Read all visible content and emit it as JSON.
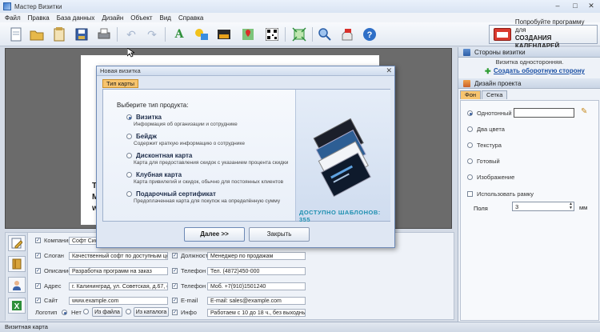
{
  "window": {
    "title": "Мастер Визитки"
  },
  "menu": [
    "Файл",
    "Правка",
    "База данных",
    "Дизайн",
    "Объект",
    "Вид",
    "Справка"
  ],
  "toolbar": {
    "icons": [
      "new-document-icon",
      "open-folder-icon",
      "templates-icon",
      "save-icon",
      "print-icon",
      "undo-icon",
      "redo-icon",
      "text-icon",
      "shape-icon",
      "image-icon",
      "map-icon",
      "qr-code-icon",
      "crop-icon",
      "zoom-icon",
      "web-icon",
      "help-icon"
    ],
    "promo": {
      "line1": "Попробуйте программу для",
      "line2": "СОЗДАНИЯ КАЛЕНДАРЕЙ"
    }
  },
  "canvas": {
    "frag1": "T",
    "frag2": "M",
    "frag3": "w"
  },
  "right_panel": {
    "sides_header": "Стороны визитки",
    "sides_info": "Визитка односторонняя.",
    "create_back_link": "Создать оборотную сторону",
    "design_header": "Дизайн проекта",
    "tabs": [
      "Фон",
      "Сетка"
    ],
    "options": [
      "Однотонный",
      "Два цвета",
      "Текстура",
      "Готовый",
      "Изображение"
    ],
    "frame_checkbox": "Использовать рамку",
    "margins_label": "Поля",
    "margins_value": "3",
    "margins_unit": "мм",
    "fill_color": "#ffffff"
  },
  "form": {
    "left": [
      {
        "label": "Компания",
        "value": "Софт Систем"
      },
      {
        "label": "Слоган",
        "value": "Качественный софт по доступным ценам"
      },
      {
        "label": "Описание",
        "value": "Разработка программ на заказ"
      },
      {
        "label": "Адрес",
        "value": "г. Калининград, ул. Советская, д.67, оф.30"
      },
      {
        "label": "Сайт",
        "value": "www.example.com"
      }
    ],
    "right": [
      {
        "label": "Должность",
        "value": "Менеджер по продажам"
      },
      {
        "label": "Телефон 1",
        "value": "Тел. (4872)450-000"
      },
      {
        "label": "Телефон 2",
        "value": "Моб. +7(910)1501240"
      },
      {
        "label": "E-mail",
        "value": "E-mail: sales@example.com"
      },
      {
        "label": "Инфо",
        "value": "Работаем с 10 до 18 ч., без выходных"
      }
    ],
    "logo_label": "Логотип",
    "logo_none": "Нет",
    "logo_from_file": "Из файла",
    "logo_from_catalog": "Из каталога"
  },
  "status": {
    "text": "Визитная карта"
  },
  "modal": {
    "title": "Новая визитка",
    "tab": "Тип карты",
    "question": "Выберите тип продукта:",
    "options": [
      {
        "label": "Визитка",
        "desc": "Информация об организации и сотруднике",
        "selected": true
      },
      {
        "label": "Бейдж",
        "desc": "Содержит краткую информацию о сотруднике",
        "selected": false
      },
      {
        "label": "Дисконтная карта",
        "desc": "Карта для предоставления скидок с указанием процента скидки",
        "selected": false
      },
      {
        "label": "Клубная карта",
        "desc": "Карта привилегий и скидок, обычно для постоянных клиентов",
        "selected": false
      },
      {
        "label": "Подарочный сертификат",
        "desc": "Предоплаченная карта для покупок на определённую сумму",
        "selected": false
      }
    ],
    "templates_count": "ДОСТУПНО ШАБЛОНОВ: 355",
    "next_button": "Далее >>",
    "close_button": "Закрыть"
  }
}
